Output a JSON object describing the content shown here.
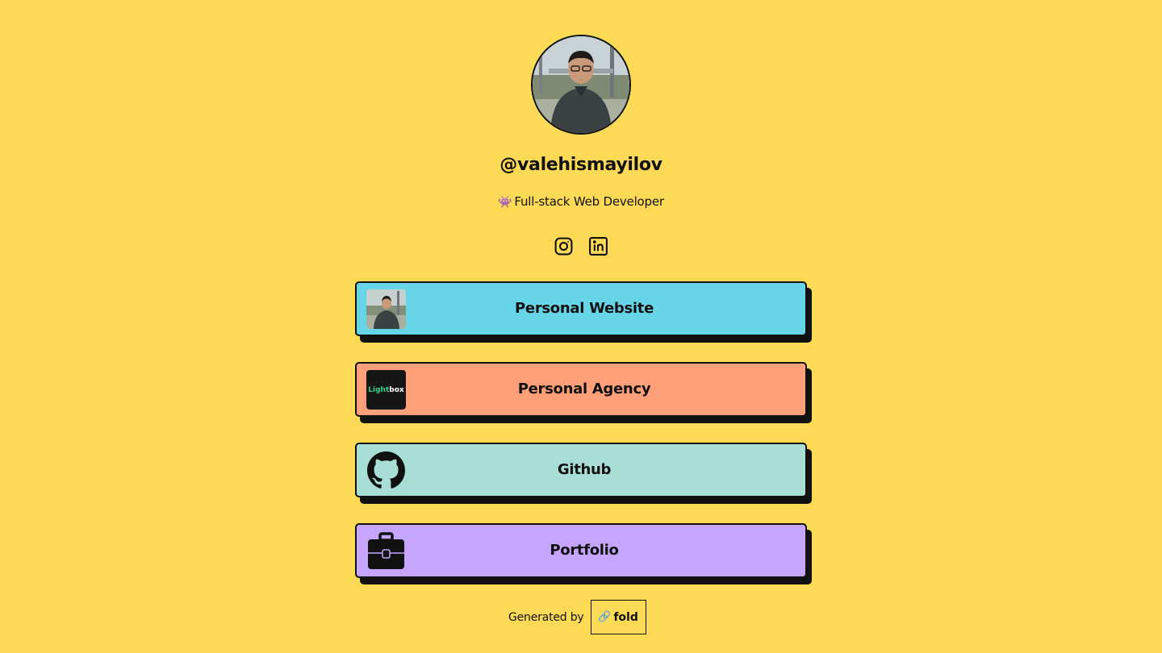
{
  "profile": {
    "username": "@valehismayilov",
    "bio_emoji": "👾",
    "bio_text": "Full-stack Web Developer"
  },
  "socials": [
    {
      "icon": "instagram-icon"
    },
    {
      "icon": "linkedin-icon"
    }
  ],
  "links": [
    {
      "label": "Personal Website",
      "color": "#67D5E8",
      "thumb": "avatar-photo"
    },
    {
      "label": "Personal Agency",
      "color": "#FFA07A",
      "thumb": "lightbox-logo",
      "thumb_text_a": "Light",
      "thumb_text_b": "box"
    },
    {
      "label": "Github",
      "color": "#A8DED6",
      "thumb": "github-icon"
    },
    {
      "label": "Portfolio",
      "color": "#C6A5FF",
      "thumb": "briefcase-icon"
    }
  ],
  "footer": {
    "generated_by": "Generated by",
    "brand_icon": "🔗",
    "brand": "fold"
  },
  "colors": {
    "background": "#FDDA55",
    "ink": "#111111"
  }
}
